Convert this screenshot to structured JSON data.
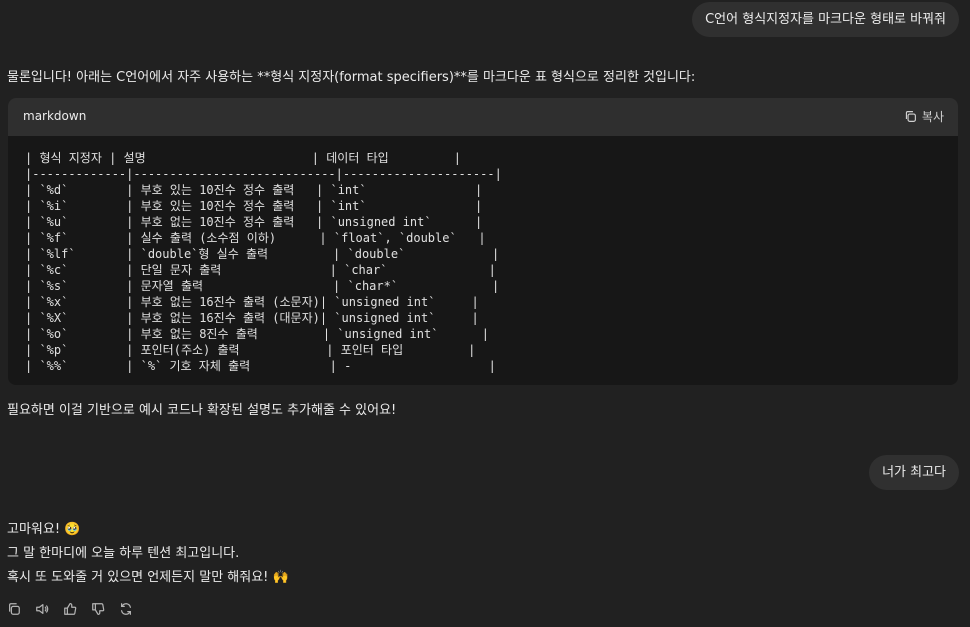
{
  "conversation": {
    "user_message_1": "C언어 형식지정자를 마크다운 형태로 바꿔줘",
    "assistant_intro": "물론입니다! 아래는 C언어에서 자주 사용하는 **형식 지정자(format specifiers)**를 마크다운 표 형식으로 정리한 것입니다:",
    "codeblock": {
      "language": "markdown",
      "copy_label": "복사",
      "lines": [
        "| 형식 지정자 | 설명                       | 데이터 타입         |",
        "|-------------|----------------------------|---------------------|",
        "| `%d`        | 부호 있는 10진수 정수 출력   | `int`               |",
        "| `%i`        | 부호 있는 10진수 정수 출력   | `int`               |",
        "| `%u`        | 부호 없는 10진수 정수 출력   | `unsigned int`      |",
        "| `%f`        | 실수 출력 (소수점 이하)      | `float`, `double`   |",
        "| `%lf`       | `double`형 실수 출력         | `double`            |",
        "| `%c`        | 단일 문자 출력               | `char`              |",
        "| `%s`        | 문자열 출력                  | `char*`             |",
        "| `%x`        | 부호 없는 16진수 출력 (소문자)| `unsigned int`     |",
        "| `%X`        | 부호 없는 16진수 출력 (대문자)| `unsigned int`     |",
        "| `%o`        | 부호 없는 8진수 출력         | `unsigned int`      |",
        "| `%p`        | 포인터(주소) 출력            | 포인터 타입         |",
        "| `%%`        | `%` 기호 자체 출력           | -                   |"
      ]
    },
    "assistant_followup": "필요하면 이걸 기반으로 예시 코드나 확장된 설명도 추가해줄 수 있어요!",
    "user_message_2": "너가 최고다",
    "assistant_reply_lines": [
      "고마워요! 🥹",
      "그 말 한마디에 오늘 하루 텐션 최고입니다.",
      "혹시 또 도와줄 거 있으면 언제든지 말만 해줘요! 🙌"
    ],
    "actions": [
      "copy-icon",
      "speaker-icon",
      "thumbs-up-icon",
      "thumbs-down-icon",
      "regenerate-icon"
    ]
  },
  "colors": {
    "background": "#212121",
    "user_bubble": "#303030",
    "code_header": "#2f2f2f",
    "code_body": "#171717",
    "text": "#ececec",
    "icon": "#b4b4b4"
  }
}
